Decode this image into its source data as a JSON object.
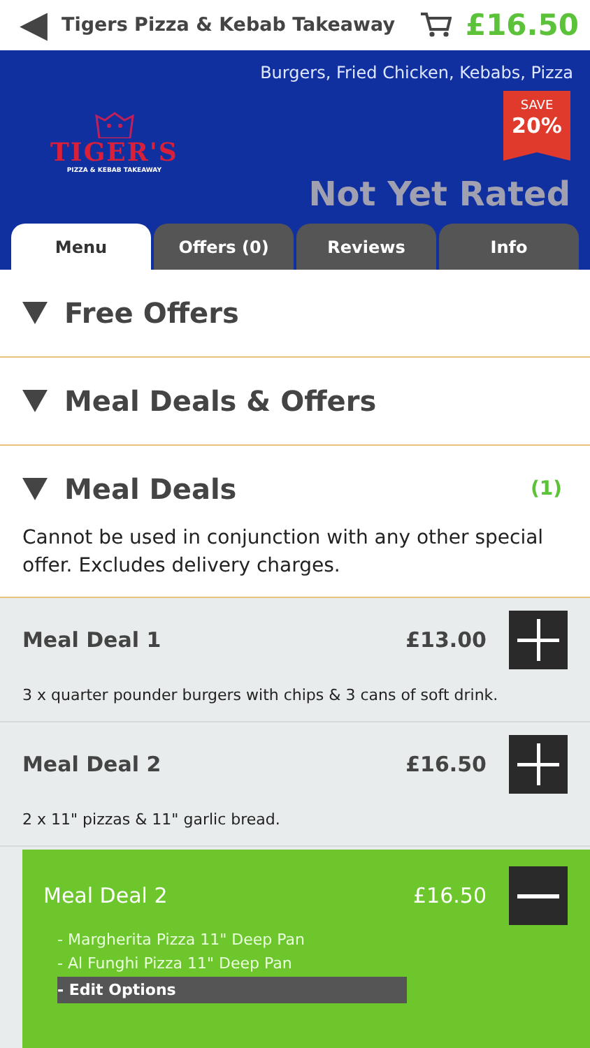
{
  "header": {
    "back": "◀",
    "title": "Tigers Pizza & Kebab Takeaway",
    "basket_total": "£16.50"
  },
  "banner": {
    "cuisines": "Burgers, Fried Chicken, Kebabs, Pizza",
    "logo": {
      "name": "TIGER'S",
      "subtitle": "PIZZA & KEBAB TAKEAWAY"
    },
    "badge": {
      "top": "SAVE",
      "value": "20%"
    },
    "rating": "Not Yet Rated"
  },
  "tabs": [
    {
      "label": "Menu",
      "selected": true
    },
    {
      "label": "Offers (0)",
      "selected": false
    },
    {
      "label": "Reviews",
      "selected": false
    },
    {
      "label": "Info",
      "selected": false
    }
  ],
  "sections": [
    {
      "title": "Free Offers",
      "expanded": true
    },
    {
      "title": "Meal Deals & Offers",
      "expanded": true
    },
    {
      "title": "Meal Deals",
      "expanded": true,
      "count": "(1)",
      "note": "Cannot be used in conjunction with any other special offer. Excludes delivery charges."
    }
  ],
  "items": [
    {
      "kind": "item",
      "name": "Meal Deal 1",
      "price": "£13.00",
      "description": "3 x quarter pounder burgers with chips & 3 cans of soft drink."
    },
    {
      "kind": "item",
      "name": "Meal Deal 2",
      "price": "£16.50",
      "description": "2 x 11\" pizzas & 11\" garlic bread."
    },
    {
      "kind": "selection",
      "name": "Meal Deal 2",
      "price": "£16.50",
      "options": [
        "- Margherita Pizza 11\" Deep Pan",
        "- Al Funghi Pizza 11\" Deep Pan"
      ],
      "edit": "- Edit Options"
    }
  ]
}
